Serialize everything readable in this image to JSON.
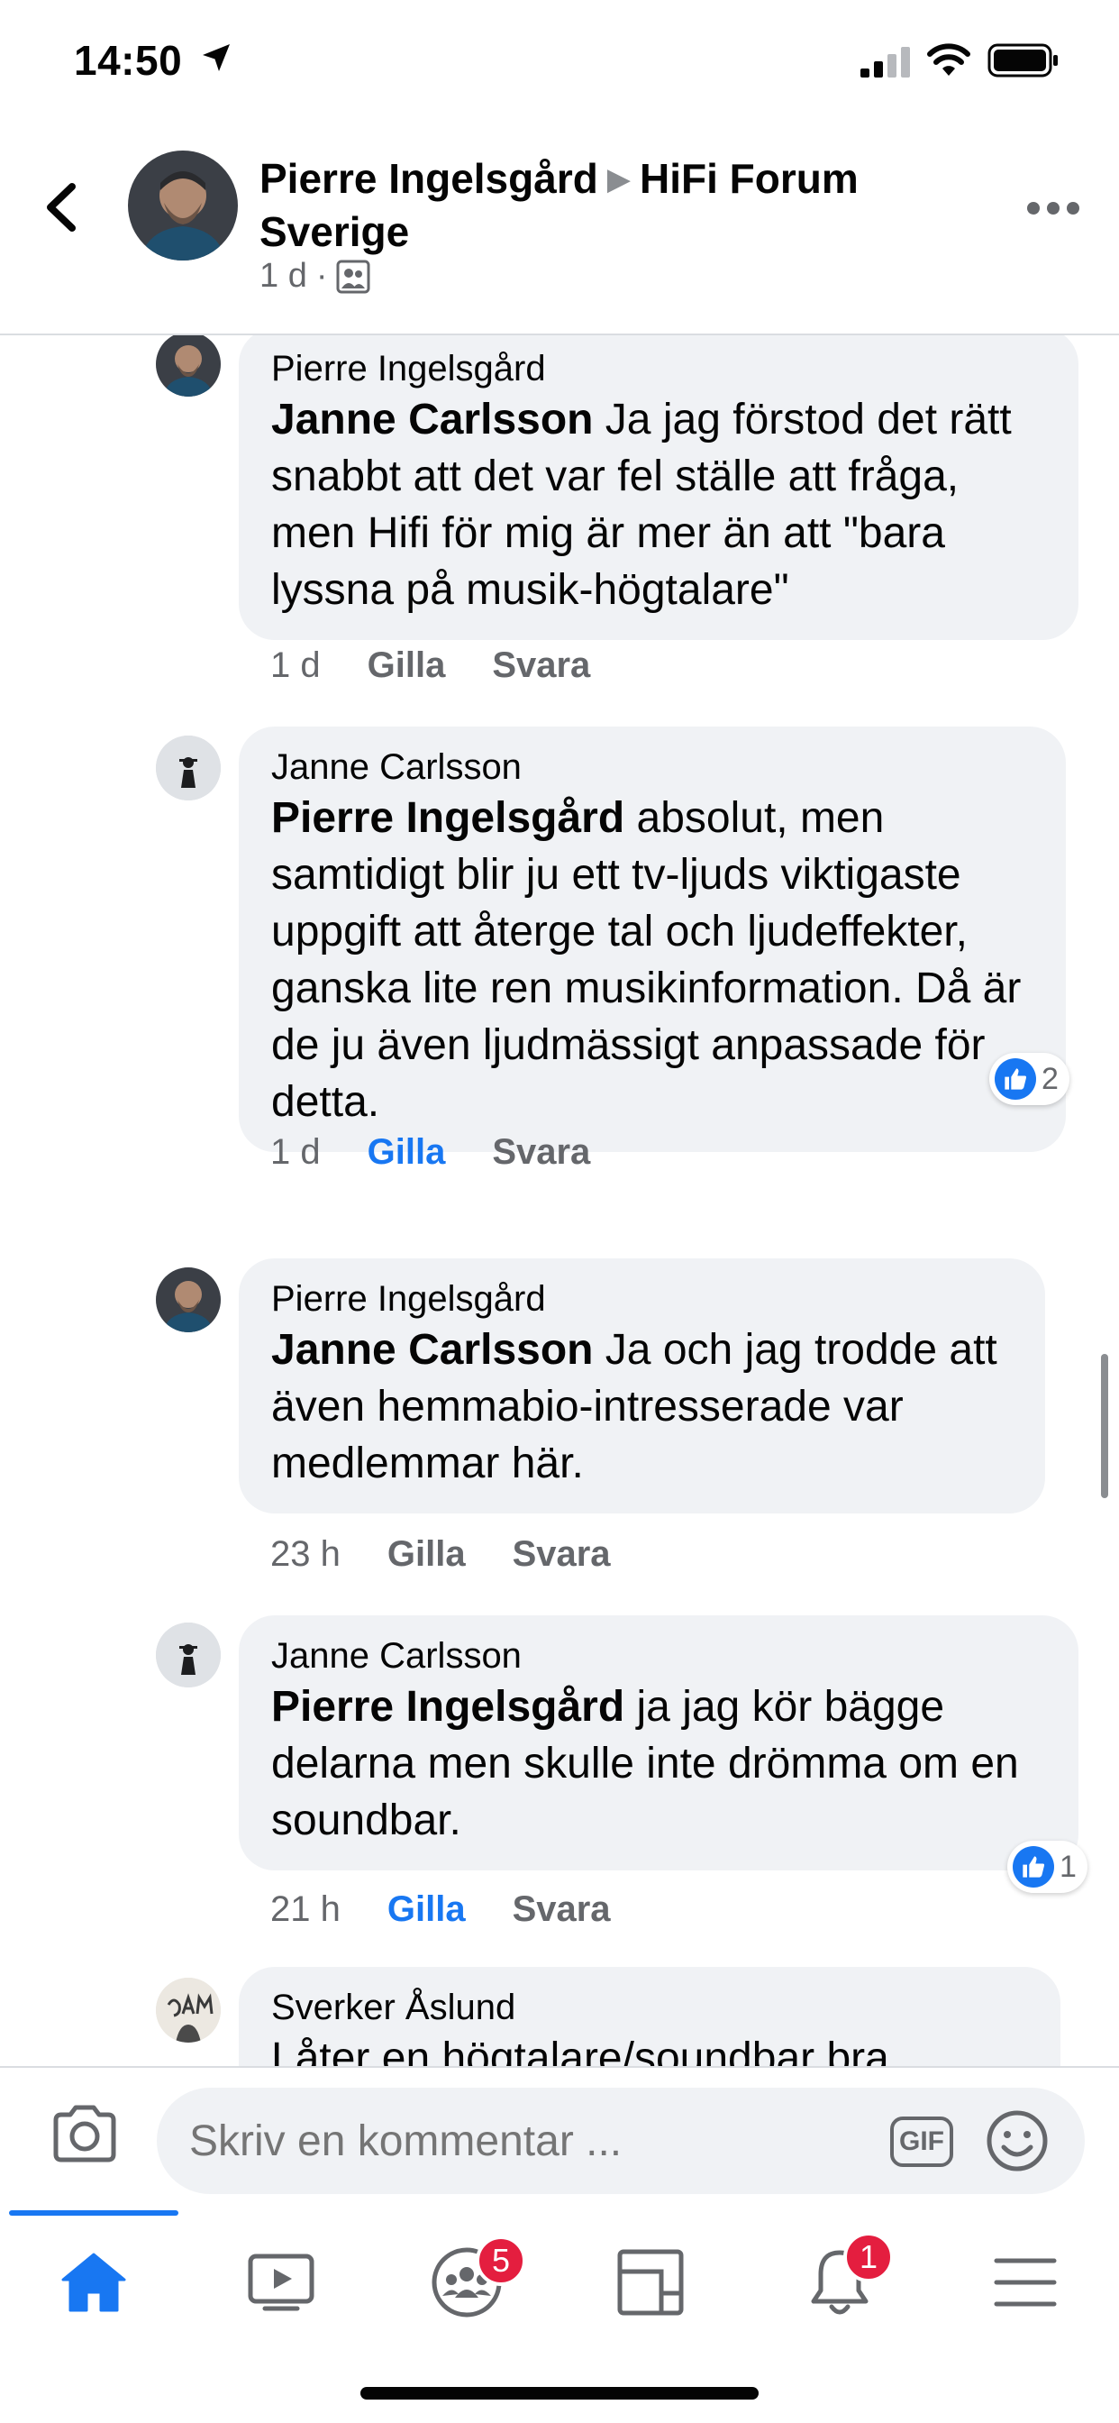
{
  "status_bar": {
    "time": "14:50"
  },
  "header": {
    "author": "Pierre Ingelsgård",
    "group": "HiFi Forum Sverige",
    "time": "1 d",
    "separator": "·"
  },
  "comments": [
    {
      "author": "Pierre Ingelsgård",
      "mention": "Janne Carlsson",
      "text": " Ja jag förstod det rätt snabbt att det var fel ställe att fråga, men Hifi för mig är mer än att \"bara lyssna på musik-högtalare\"",
      "time": "1 d",
      "like": "Gilla",
      "reply": "Svara",
      "liked": false,
      "reactions": null
    },
    {
      "author": "Janne Carlsson",
      "mention": "Pierre Ingelsgård",
      "text": " absolut, men samtidigt blir ju ett tv-ljuds viktigaste uppgift att återge tal och ljudeffekter, ganska lite ren musikinformation. Då är de ju även ljudmässigt anpassade för detta.",
      "time": "1 d",
      "like": "Gilla",
      "reply": "Svara",
      "liked": true,
      "reactions": "2"
    },
    {
      "author": "Pierre Ingelsgård",
      "mention": "Janne Carlsson",
      "text": " Ja och jag trodde att även hemmabio-intresserade var medlemmar här.",
      "time": "23 h",
      "like": "Gilla",
      "reply": "Svara",
      "liked": false,
      "reactions": null
    },
    {
      "author": "Janne Carlsson",
      "mention": "Pierre Ingelsgård",
      "text": " ja jag kör bägge delarna men skulle inte drömma om en soundbar.",
      "time": "21 h",
      "like": "Gilla",
      "reply": "Svara",
      "liked": true,
      "reactions": "1"
    },
    {
      "author": "Sverker Åslund",
      "mention": "",
      "text": "Låter en högtalare/soundbar bra",
      "time": "",
      "like": "",
      "reply": "",
      "liked": false,
      "reactions": null
    }
  ],
  "composer": {
    "placeholder": "Skriv en kommentar ...",
    "gif_label": "GIF"
  },
  "tabs": {
    "groups_badge": "5",
    "notifications_badge": "1"
  },
  "colors": {
    "accent": "#1877f2",
    "badge": "#e41e3f",
    "bubble": "#f0f2f5",
    "secondary_text": "#65676b"
  },
  "icons": [
    "location-arrow-icon",
    "signal-icon",
    "wifi-icon",
    "battery-icon",
    "back-arrow-icon",
    "group-privacy-icon",
    "more-icon",
    "like-icon",
    "camera-icon",
    "gif-icon",
    "emoji-icon",
    "home-icon",
    "watch-icon",
    "groups-icon",
    "pages-icon",
    "bell-icon",
    "menu-icon"
  ]
}
